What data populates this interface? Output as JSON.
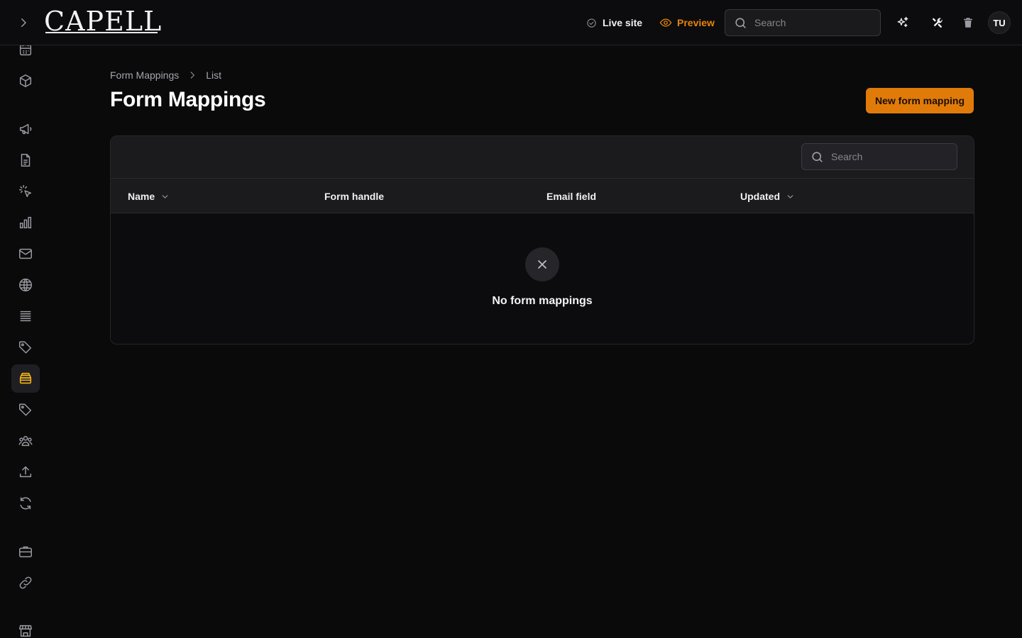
{
  "app": {
    "logo_text": "CAPELL"
  },
  "topbar": {
    "live_site_label": "Live site",
    "preview_label": "Preview",
    "search_placeholder": "Search",
    "avatar_initials": "TU"
  },
  "colors": {
    "accent": "#e07b0a",
    "background": "#0a0a0b",
    "panel": "#1b1b1e"
  },
  "sidebar": {
    "items": [
      {
        "icon": "calendar-icon",
        "active": false
      },
      {
        "icon": "cube-icon",
        "active": false
      },
      {
        "icon": "megaphone-icon",
        "active": false
      },
      {
        "icon": "document-icon",
        "active": false
      },
      {
        "icon": "cursor-click-icon",
        "active": false
      },
      {
        "icon": "bar-chart-icon",
        "active": false
      },
      {
        "icon": "envelope-icon",
        "active": false
      },
      {
        "icon": "globe-icon",
        "active": false
      },
      {
        "icon": "stack-icon",
        "active": false
      },
      {
        "icon": "tag-icon",
        "active": false
      },
      {
        "icon": "inbox-stack-icon",
        "active": true
      },
      {
        "icon": "tag-icon",
        "active": false
      },
      {
        "icon": "user-group-icon",
        "active": false
      },
      {
        "icon": "upload-icon",
        "active": false
      },
      {
        "icon": "refresh-icon",
        "active": false
      },
      {
        "icon": "briefcase-icon",
        "active": false
      },
      {
        "icon": "link-icon",
        "active": false
      },
      {
        "icon": "storefront-icon",
        "active": false
      }
    ]
  },
  "breadcrumb": {
    "items": [
      "Form Mappings",
      "List"
    ]
  },
  "page": {
    "title": "Form Mappings",
    "primary_action": "New form mapping"
  },
  "table": {
    "search_placeholder": "Search",
    "columns": [
      {
        "label": "Name",
        "sortable": true
      },
      {
        "label": "Form handle",
        "sortable": false
      },
      {
        "label": "Email field",
        "sortable": false
      },
      {
        "label": "Updated",
        "sortable": true
      }
    ],
    "rows": [],
    "empty_message": "No form mappings"
  }
}
